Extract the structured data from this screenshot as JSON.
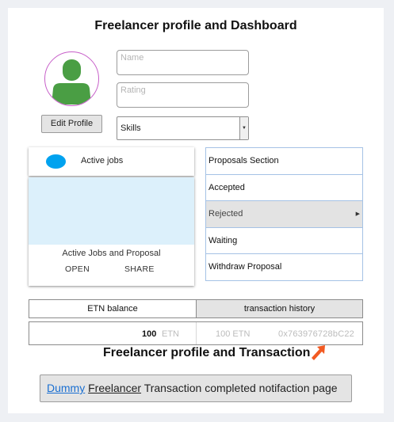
{
  "header": {
    "title": "Freelancer profile and Dashboard"
  },
  "profile": {
    "edit_button": "Edit Profile",
    "name_placeholder": "Name",
    "rating_placeholder": "Rating",
    "skills_select": "Skills"
  },
  "active_jobs": {
    "header_label": "Active jobs",
    "card_title": "Active Jobs and Proposal",
    "open_action": "OPEN",
    "share_action": "SHARE"
  },
  "proposals": {
    "items": [
      {
        "label": "Proposals Section"
      },
      {
        "label": "Accepted"
      },
      {
        "label": "Rejected"
      },
      {
        "label": "Waiting"
      },
      {
        "label": "Withdraw Proposal"
      }
    ]
  },
  "wallet": {
    "tabs": [
      "ETN balance",
      "transaction history"
    ],
    "balance_value": "100",
    "balance_unit": "ETN",
    "history_amount": "100 ETN",
    "history_address": "0x763976728bC22"
  },
  "transaction": {
    "title": "Freelancer profile and Transaction"
  },
  "notification": {
    "link_text": "Dummy",
    "name_text": "Freelancer",
    "message": "Transaction completed notifaction page"
  },
  "colors": {
    "accent_blue": "#00a2ef",
    "card_media": "#dcf0fb",
    "avatar_green": "#4a9e44",
    "avatar_border": "#c75fc9",
    "arrow": "#f25a22"
  }
}
